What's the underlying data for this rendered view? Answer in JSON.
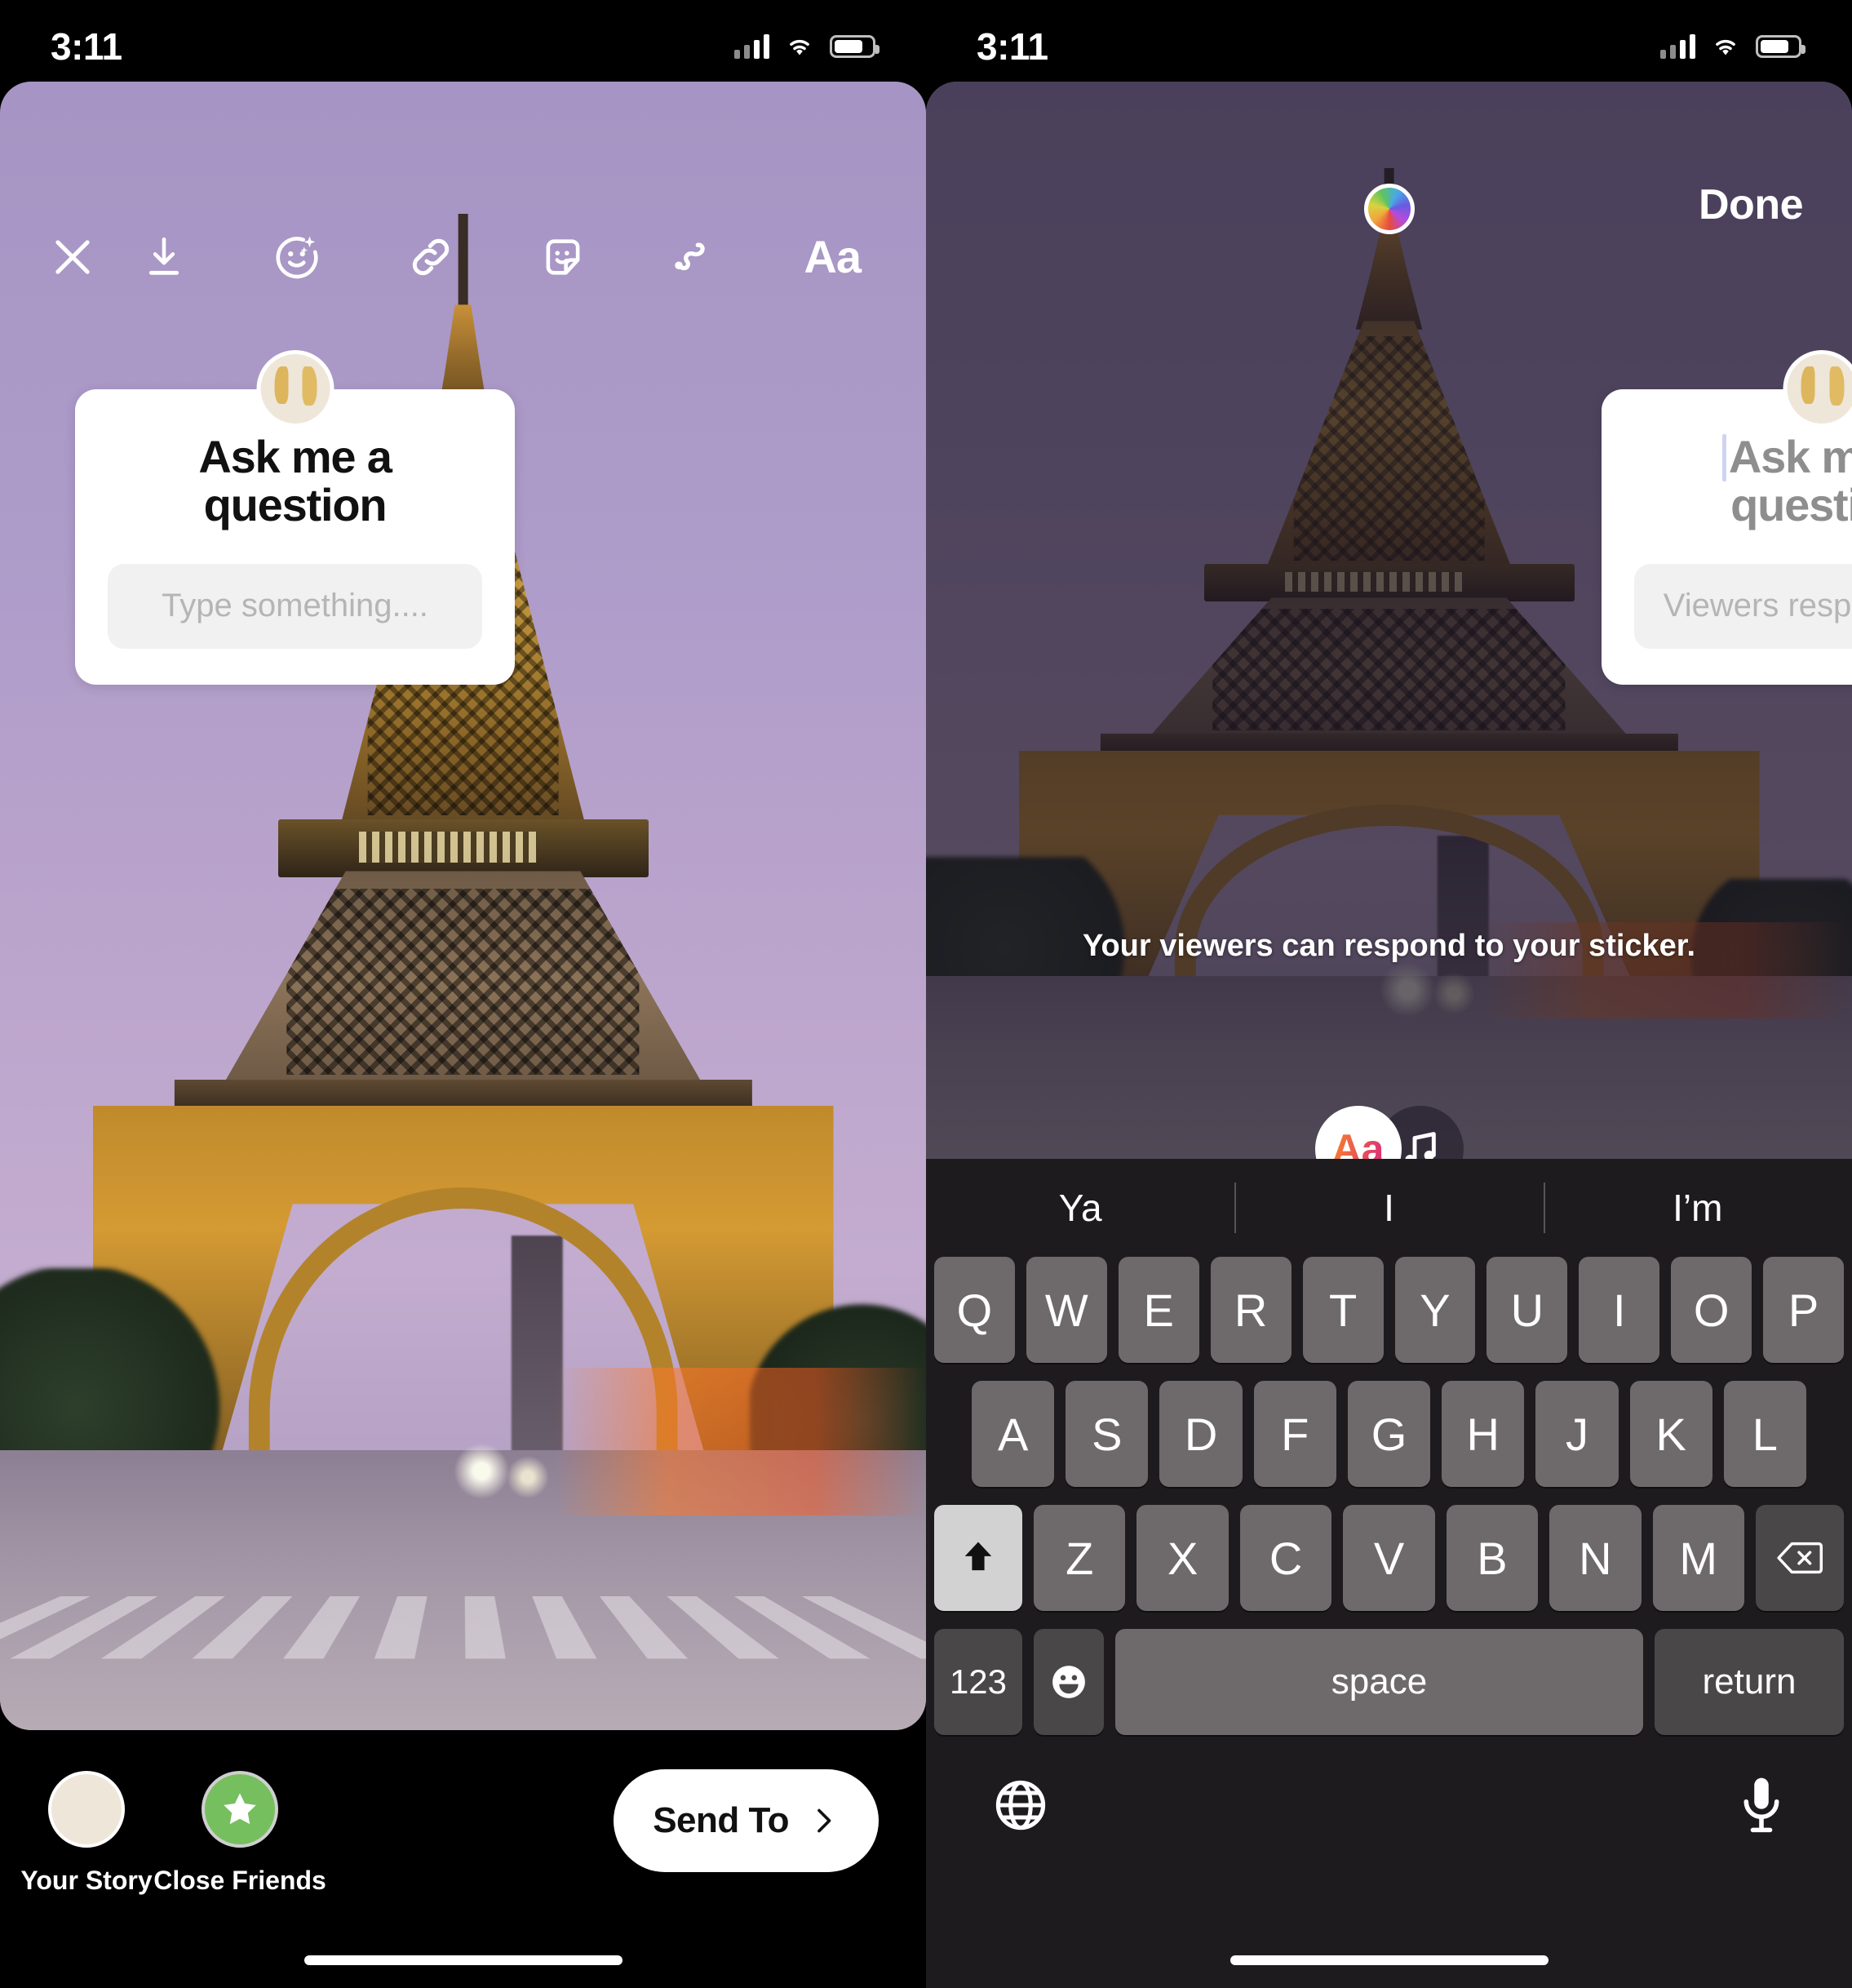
{
  "status_bar": {
    "time": "3:11"
  },
  "left_phone": {
    "toolbar": [
      {
        "name": "close-icon",
        "label": "Close"
      },
      {
        "name": "download-icon",
        "label": "Save"
      },
      {
        "name": "effects-icon",
        "label": "Effects"
      },
      {
        "name": "link-icon",
        "label": "Link"
      },
      {
        "name": "sticker-icon",
        "label": "Sticker"
      },
      {
        "name": "draw-icon",
        "label": "Draw"
      },
      {
        "name": "text-icon",
        "label": "Aa"
      }
    ],
    "sticker": {
      "title": "Ask me a question",
      "input_placeholder": "Type something...."
    },
    "bottom": {
      "your_story_label": "Your Story",
      "close_friends_label": "Close Friends",
      "send_to_label": "Send To"
    }
  },
  "right_phone": {
    "done_label": "Done",
    "sticker": {
      "title_placeholder": "Ask me a question",
      "input_placeholder": "Viewers respond here"
    },
    "hint": "Your viewers can respond to your sticker.",
    "style_pills": {
      "text_style_label": "Aa",
      "music_label": "Music"
    },
    "keyboard": {
      "suggestions": [
        "Ya",
        "I",
        "I’m"
      ],
      "row1": [
        "Q",
        "W",
        "E",
        "R",
        "T",
        "Y",
        "U",
        "I",
        "O",
        "P"
      ],
      "row2": [
        "A",
        "S",
        "D",
        "F",
        "G",
        "H",
        "J",
        "K",
        "L"
      ],
      "row3": [
        "Z",
        "X",
        "C",
        "V",
        "B",
        "N",
        "M"
      ],
      "shift_label": "shift",
      "delete_label": "delete",
      "numbers_label": "123",
      "emoji_label": "emoji",
      "space_label": "space",
      "return_label": "return",
      "globe_label": "globe",
      "mic_label": "dictation"
    }
  },
  "colors": {
    "accent_green": "#76bf5e",
    "card_white": "#ffffff",
    "input_gray": "#f1f1f1",
    "keyboard_bg": "#1e1b1e",
    "key_bg": "#6e6a6c"
  }
}
